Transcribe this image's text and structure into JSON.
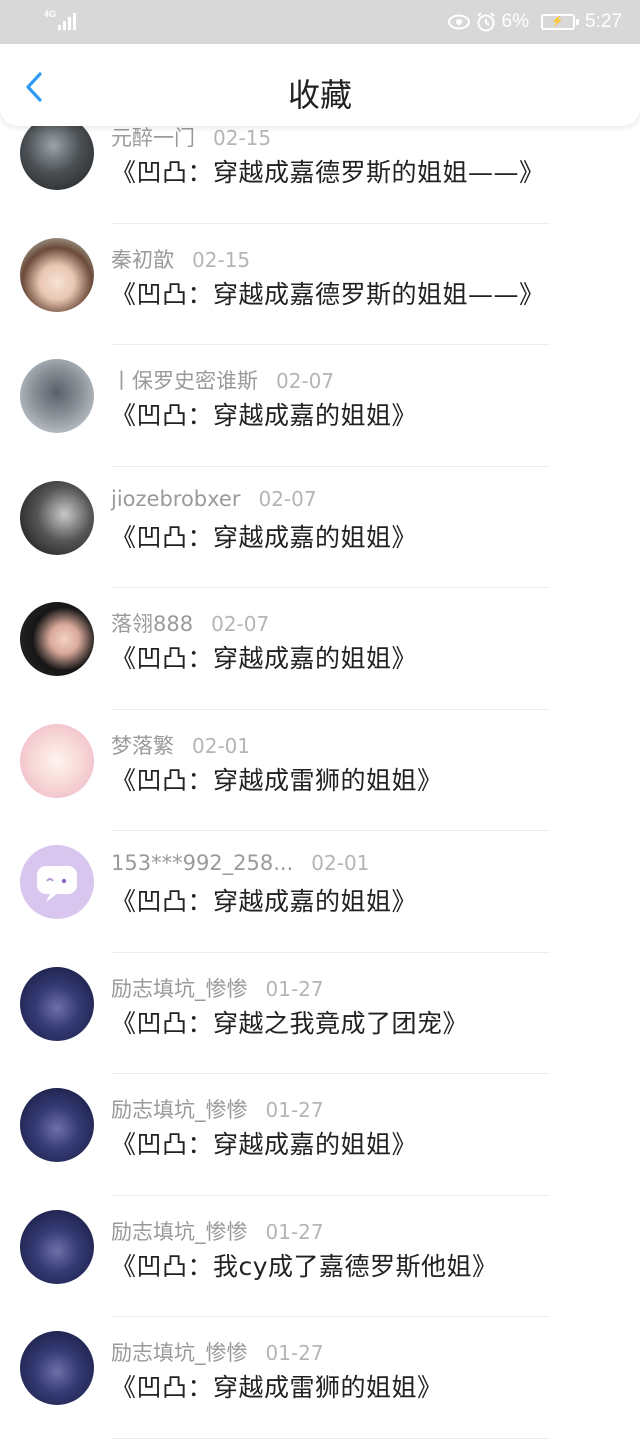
{
  "status_bar": {
    "network": "4G",
    "battery_percent": "6%",
    "time": "5:27"
  },
  "nav": {
    "title": "收藏",
    "back_icon": "chevron-left-icon"
  },
  "accent_color": "#2f9bf4",
  "items": [
    {
      "user": "元醉一门",
      "date": "02-15",
      "title": "《凹凸：穿越成嘉德罗斯的姐姐——》",
      "avatar": "photo-dark-girl"
    },
    {
      "user": "秦初歆",
      "date": "02-15",
      "title": "《凹凸：穿越成嘉德罗斯的姐姐——》",
      "avatar": "anime-girl-brown-hair"
    },
    {
      "user": "丨保罗史密谁斯",
      "date": "02-07",
      "title": "《凹凸：穿越成嘉的姐姐》",
      "avatar": "photo-couple"
    },
    {
      "user": "jiozebrobxer",
      "date": "02-07",
      "title": "《凹凸：穿越成嘉的姐姐》",
      "avatar": "photo-bw-girl"
    },
    {
      "user": "落翎888",
      "date": "02-07",
      "title": "《凹凸：穿越成嘉的姐姐》",
      "avatar": "anime-girl-black-hair"
    },
    {
      "user": "梦落繁",
      "date": "02-01",
      "title": "《凹凸：穿越成雷狮的姐姐》",
      "avatar": "anime-chibi-pink"
    },
    {
      "user": "153***992_258...",
      "date": "02-01",
      "title": "《凹凸：穿越成嘉的姐姐》",
      "avatar": "default-chat-bubble"
    },
    {
      "user": "励志填坑_惨惨",
      "date": "01-27",
      "title": "《凹凸：穿越之我竟成了团宠》",
      "avatar": "anime-dark-blue"
    },
    {
      "user": "励志填坑_惨惨",
      "date": "01-27",
      "title": "《凹凸：穿越成嘉的姐姐》",
      "avatar": "anime-dark-blue"
    },
    {
      "user": "励志填坑_惨惨",
      "date": "01-27",
      "title": "《凹凸：我cy成了嘉德罗斯他姐》",
      "avatar": "anime-dark-blue"
    },
    {
      "user": "励志填坑_惨惨",
      "date": "01-27",
      "title": "《凹凸：穿越成雷狮的姐姐》",
      "avatar": "anime-dark-blue"
    }
  ]
}
